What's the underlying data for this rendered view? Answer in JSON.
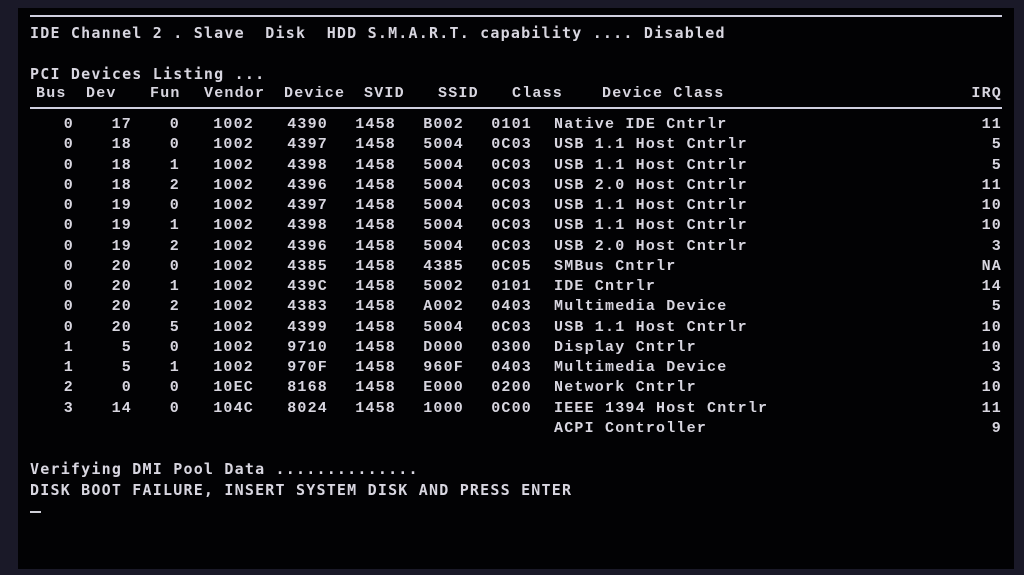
{
  "status_line": "IDE Channel 2 . Slave  Disk  HDD S.M.A.R.T. capability .... Disabled",
  "listing_title": "PCI Devices Listing ...",
  "headers": {
    "bus": "Bus",
    "dev": "Dev",
    "fun": "Fun",
    "vendor": "Vendor",
    "device": "Device",
    "svid": "SVID",
    "ssid": "SSID",
    "class": "Class",
    "name": "Device Class",
    "irq": "IRQ"
  },
  "rows": [
    {
      "bus": "0",
      "dev": "17",
      "fun": "0",
      "vendor": "1002",
      "device": "4390",
      "svid": "1458",
      "ssid": "B002",
      "class": "0101",
      "name": "Native IDE Cntrlr",
      "irq": "11"
    },
    {
      "bus": "0",
      "dev": "18",
      "fun": "0",
      "vendor": "1002",
      "device": "4397",
      "svid": "1458",
      "ssid": "5004",
      "class": "0C03",
      "name": "USB 1.1 Host Cntrlr",
      "irq": "5"
    },
    {
      "bus": "0",
      "dev": "18",
      "fun": "1",
      "vendor": "1002",
      "device": "4398",
      "svid": "1458",
      "ssid": "5004",
      "class": "0C03",
      "name": "USB 1.1 Host Cntrlr",
      "irq": "5"
    },
    {
      "bus": "0",
      "dev": "18",
      "fun": "2",
      "vendor": "1002",
      "device": "4396",
      "svid": "1458",
      "ssid": "5004",
      "class": "0C03",
      "name": "USB 2.0 Host Cntrlr",
      "irq": "11"
    },
    {
      "bus": "0",
      "dev": "19",
      "fun": "0",
      "vendor": "1002",
      "device": "4397",
      "svid": "1458",
      "ssid": "5004",
      "class": "0C03",
      "name": "USB 1.1 Host Cntrlr",
      "irq": "10"
    },
    {
      "bus": "0",
      "dev": "19",
      "fun": "1",
      "vendor": "1002",
      "device": "4398",
      "svid": "1458",
      "ssid": "5004",
      "class": "0C03",
      "name": "USB 1.1 Host Cntrlr",
      "irq": "10"
    },
    {
      "bus": "0",
      "dev": "19",
      "fun": "2",
      "vendor": "1002",
      "device": "4396",
      "svid": "1458",
      "ssid": "5004",
      "class": "0C03",
      "name": "USB 2.0 Host Cntrlr",
      "irq": "3"
    },
    {
      "bus": "0",
      "dev": "20",
      "fun": "0",
      "vendor": "1002",
      "device": "4385",
      "svid": "1458",
      "ssid": "4385",
      "class": "0C05",
      "name": "SMBus Cntrlr",
      "irq": "NA"
    },
    {
      "bus": "0",
      "dev": "20",
      "fun": "1",
      "vendor": "1002",
      "device": "439C",
      "svid": "1458",
      "ssid": "5002",
      "class": "0101",
      "name": "IDE Cntrlr",
      "irq": "14"
    },
    {
      "bus": "0",
      "dev": "20",
      "fun": "2",
      "vendor": "1002",
      "device": "4383",
      "svid": "1458",
      "ssid": "A002",
      "class": "0403",
      "name": "Multimedia Device",
      "irq": "5"
    },
    {
      "bus": "0",
      "dev": "20",
      "fun": "5",
      "vendor": "1002",
      "device": "4399",
      "svid": "1458",
      "ssid": "5004",
      "class": "0C03",
      "name": "USB 1.1 Host Cntrlr",
      "irq": "10"
    },
    {
      "bus": "1",
      "dev": "5",
      "fun": "0",
      "vendor": "1002",
      "device": "9710",
      "svid": "1458",
      "ssid": "D000",
      "class": "0300",
      "name": "Display Cntrlr",
      "irq": "10"
    },
    {
      "bus": "1",
      "dev": "5",
      "fun": "1",
      "vendor": "1002",
      "device": "970F",
      "svid": "1458",
      "ssid": "960F",
      "class": "0403",
      "name": "Multimedia Device",
      "irq": "3"
    },
    {
      "bus": "2",
      "dev": "0",
      "fun": "0",
      "vendor": "10EC",
      "device": "8168",
      "svid": "1458",
      "ssid": "E000",
      "class": "0200",
      "name": "Network Cntrlr",
      "irq": "10"
    },
    {
      "bus": "3",
      "dev": "14",
      "fun": "0",
      "vendor": "104C",
      "device": "8024",
      "svid": "1458",
      "ssid": "1000",
      "class": "0C00",
      "name": "IEEE 1394 Host Cntrlr",
      "irq": "11"
    }
  ],
  "trailer": {
    "name": "ACPI Controller",
    "irq": "9"
  },
  "verify": "Verifying DMI Pool Data ..............",
  "fail": "DISK BOOT FAILURE, INSERT SYSTEM DISK AND PRESS ENTER"
}
